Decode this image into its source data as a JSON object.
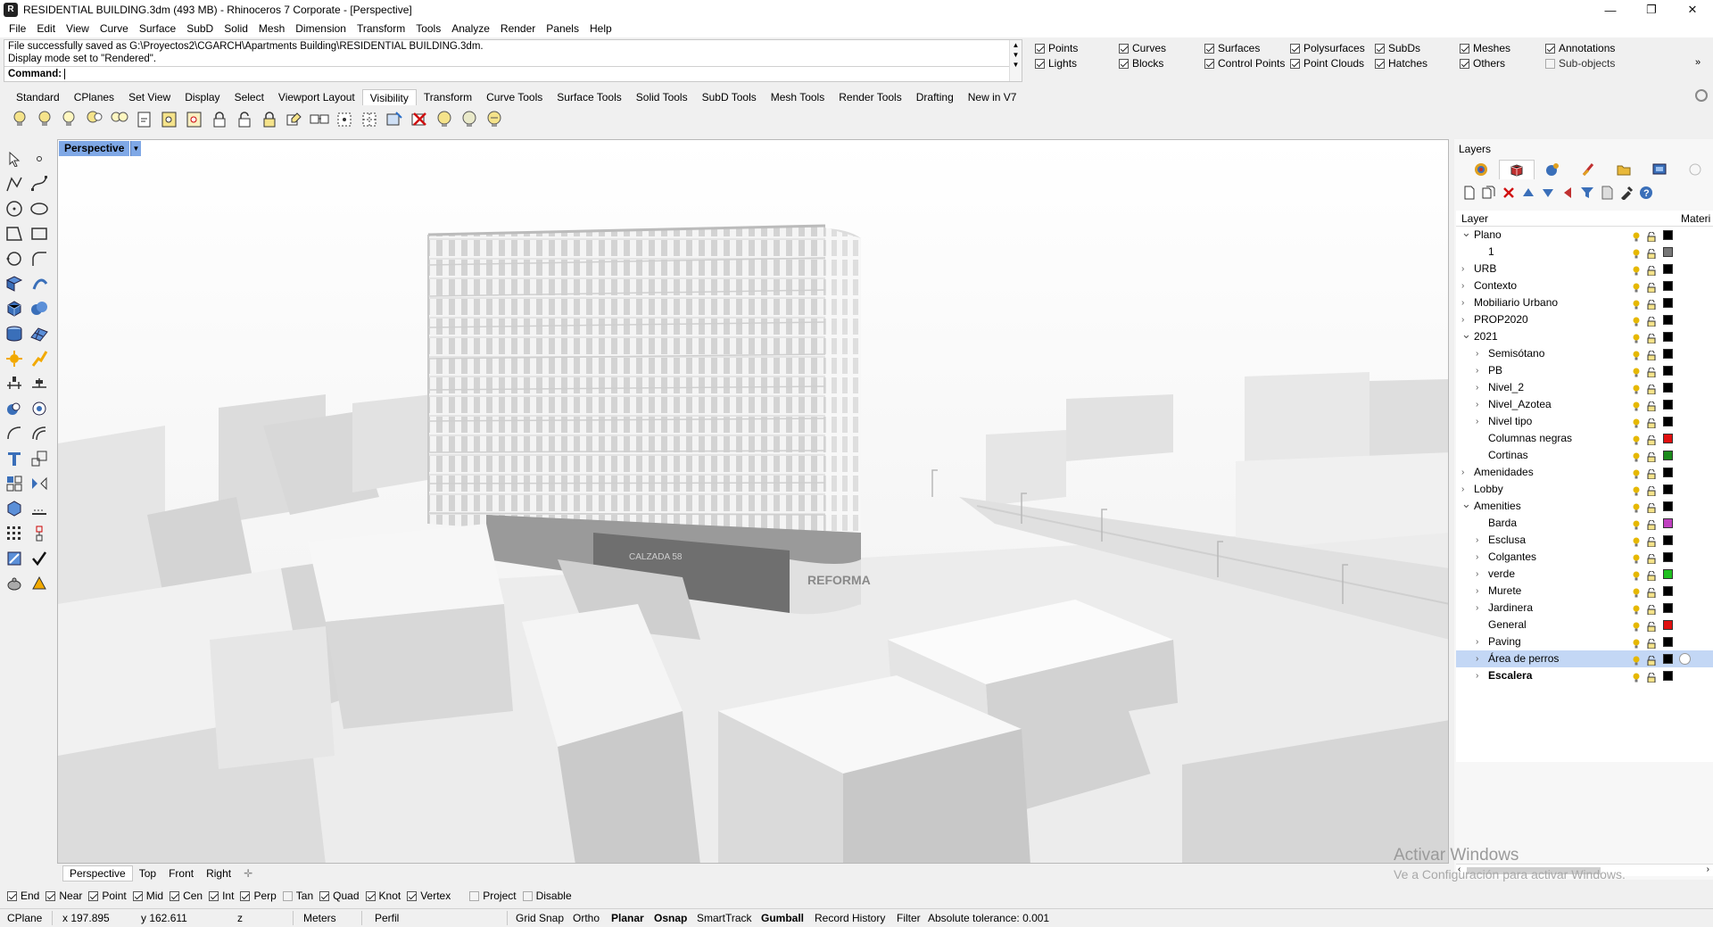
{
  "window": {
    "title": "RESIDENTIAL BUILDING.3dm (493 MB) - Rhinoceros 7 Corporate - [Perspective]",
    "minimize": "—",
    "restore": "❐",
    "close": "✕"
  },
  "menu": [
    "File",
    "Edit",
    "View",
    "Curve",
    "Surface",
    "SubD",
    "Solid",
    "Mesh",
    "Dimension",
    "Transform",
    "Tools",
    "Analyze",
    "Render",
    "Panels",
    "Help"
  ],
  "command": {
    "history_1": "File successfully saved as G:\\Proyectos2\\CGARCH\\Apartments Building\\RESIDENTIAL BUILDING.3dm.",
    "history_2": "Display mode set to \"Rendered\".",
    "prompt": "Command:",
    "value": ""
  },
  "select_filters": [
    {
      "label": "Points",
      "checked": true
    },
    {
      "label": "Curves",
      "checked": true
    },
    {
      "label": "Surfaces",
      "checked": true
    },
    {
      "label": "Polysurfaces",
      "checked": true
    },
    {
      "label": "SubDs",
      "checked": true
    },
    {
      "label": "Meshes",
      "checked": true
    },
    {
      "label": "Annotations",
      "checked": true
    },
    {
      "label": "Lights",
      "checked": true
    },
    {
      "label": "Blocks",
      "checked": true
    },
    {
      "label": "Control Points",
      "checked": true
    },
    {
      "label": "Point Clouds",
      "checked": true
    },
    {
      "label": "Hatches",
      "checked": true
    },
    {
      "label": "Others",
      "checked": true
    },
    {
      "label": "Sub-objects",
      "checked": false
    }
  ],
  "toolbar_tabs": [
    "Standard",
    "CPlanes",
    "Set View",
    "Display",
    "Select",
    "Viewport Layout",
    "Visibility",
    "Transform",
    "Curve Tools",
    "Surface Tools",
    "Solid Tools",
    "SubD Tools",
    "Mesh Tools",
    "Render Tools",
    "Drafting",
    "New in V7"
  ],
  "active_toolbar_tab": "Visibility",
  "viewport": {
    "label": "Perspective",
    "signage_1": "REFORMA",
    "signage_2": "CALZADA 58"
  },
  "viewport_tabs": [
    "Perspective",
    "Top",
    "Front",
    "Right"
  ],
  "viewport_tab_add": "✛",
  "layers_panel": {
    "title": "Layers",
    "col_layer": "Layer",
    "col_material": "Materi",
    "rows": [
      {
        "name": "Plano",
        "depth": 0,
        "expander": "open",
        "color": "#000000"
      },
      {
        "name": "1",
        "depth": 1,
        "expander": "none",
        "color": "#777777"
      },
      {
        "name": "URB",
        "depth": 0,
        "expander": "closed",
        "color": "#000000"
      },
      {
        "name": "Contexto",
        "depth": 0,
        "expander": "closed",
        "color": "#000000"
      },
      {
        "name": "Mobiliario Urbano",
        "depth": 0,
        "expander": "closed",
        "color": "#000000"
      },
      {
        "name": "PROP2020",
        "depth": 0,
        "expander": "closed",
        "color": "#000000"
      },
      {
        "name": "2021",
        "depth": 0,
        "expander": "open",
        "color": "#000000"
      },
      {
        "name": "Semisótano",
        "depth": 1,
        "expander": "closed",
        "color": "#000000"
      },
      {
        "name": "PB",
        "depth": 1,
        "expander": "closed",
        "color": "#000000"
      },
      {
        "name": "Nivel_2",
        "depth": 1,
        "expander": "closed",
        "color": "#000000"
      },
      {
        "name": "Nivel_Azotea",
        "depth": 1,
        "expander": "closed",
        "color": "#000000"
      },
      {
        "name": "Nivel tipo",
        "depth": 1,
        "expander": "closed",
        "color": "#000000"
      },
      {
        "name": "Columnas negras",
        "depth": 1,
        "expander": "none",
        "color": "#e01010"
      },
      {
        "name": "Cortinas",
        "depth": 1,
        "expander": "none",
        "color": "#1a8a1a"
      },
      {
        "name": "Amenidades",
        "depth": 0,
        "expander": "closed",
        "color": "#000000"
      },
      {
        "name": "Lobby",
        "depth": 0,
        "expander": "closed",
        "color": "#000000"
      },
      {
        "name": "Amenities",
        "depth": 0,
        "expander": "open",
        "color": "#000000"
      },
      {
        "name": "Barda",
        "depth": 1,
        "expander": "none",
        "color": "#c040c0"
      },
      {
        "name": "Esclusa",
        "depth": 1,
        "expander": "closed",
        "color": "#000000"
      },
      {
        "name": "Colgantes",
        "depth": 1,
        "expander": "closed",
        "color": "#000000"
      },
      {
        "name": "verde",
        "depth": 1,
        "expander": "closed",
        "color": "#20c020"
      },
      {
        "name": "Murete",
        "depth": 1,
        "expander": "closed",
        "color": "#000000"
      },
      {
        "name": "Jardinera",
        "depth": 1,
        "expander": "closed",
        "color": "#000000"
      },
      {
        "name": "General",
        "depth": 1,
        "expander": "none",
        "color": "#e01010"
      },
      {
        "name": "Paving",
        "depth": 1,
        "expander": "closed",
        "color": "#000000"
      },
      {
        "name": "Área de perros",
        "depth": 1,
        "expander": "closed",
        "color": "#000000",
        "selected": true
      },
      {
        "name": "Escalera",
        "depth": 1,
        "expander": "closed",
        "color": "#000000",
        "current": true
      }
    ]
  },
  "osnaps": [
    {
      "label": "End",
      "checked": true
    },
    {
      "label": "Near",
      "checked": true
    },
    {
      "label": "Point",
      "checked": true
    },
    {
      "label": "Mid",
      "checked": true
    },
    {
      "label": "Cen",
      "checked": true
    },
    {
      "label": "Int",
      "checked": true
    },
    {
      "label": "Perp",
      "checked": true
    },
    {
      "label": "Tan",
      "checked": false
    },
    {
      "label": "Quad",
      "checked": true
    },
    {
      "label": "Knot",
      "checked": true
    },
    {
      "label": "Vertex",
      "checked": true
    },
    {
      "label": "Project",
      "checked": false
    },
    {
      "label": "Disable",
      "checked": false
    }
  ],
  "statusbar": {
    "cplane": "CPlane",
    "x": "x 197.895",
    "y": "y 162.611",
    "z": "z",
    "units": "Meters",
    "layer": "Perfil",
    "grid_snap": "Grid Snap",
    "ortho": "Ortho",
    "planar": "Planar",
    "osnap": "Osnap",
    "smarttrack": "SmartTrack",
    "gumball": "Gumball",
    "record_history": "Record History",
    "filter": "Filter",
    "tolerance": "Absolute tolerance: 0.001"
  },
  "watermark": {
    "line1": "Activar Windows",
    "line2": "Ve a Configuración para activar Windows."
  },
  "colors": {
    "viewport_label_bg": "#7fa8e6",
    "selected_layer_bg": "#c3d7f5",
    "bulb": "#e6b800"
  }
}
